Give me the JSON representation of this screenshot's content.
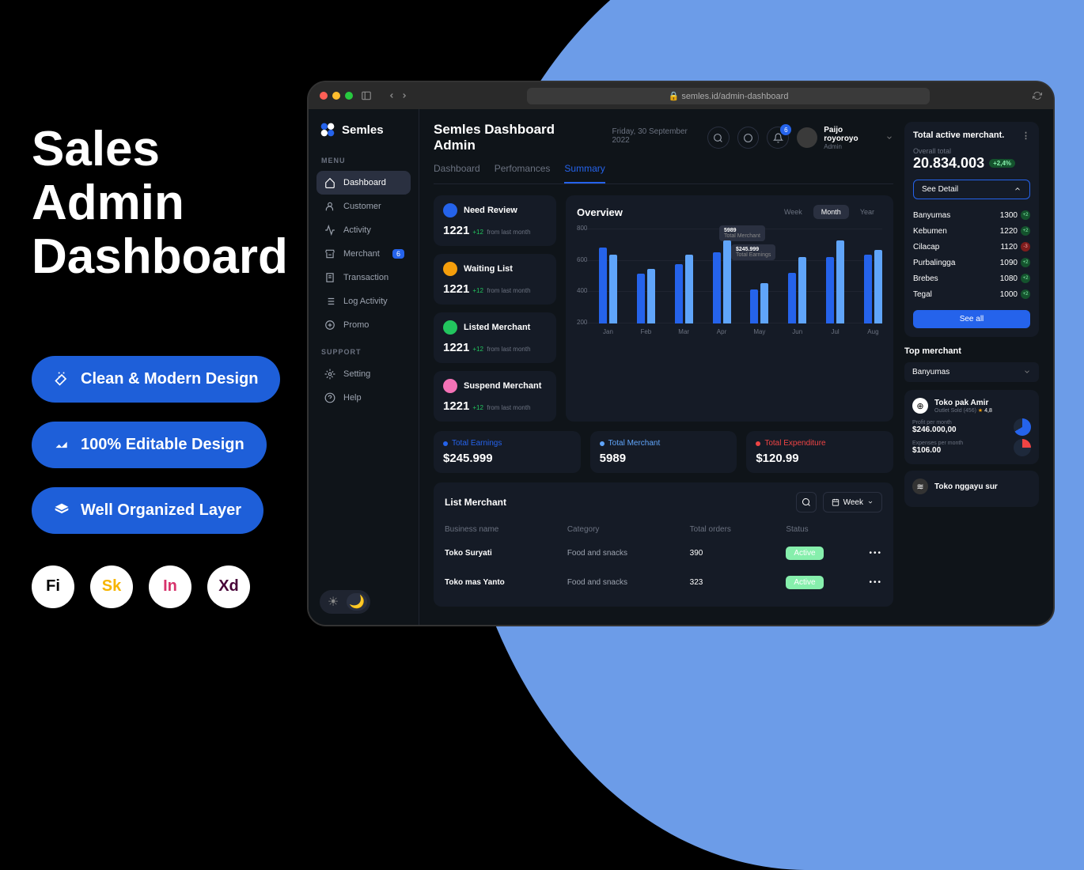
{
  "promo": {
    "title_line1": "Sales",
    "title_line2": "Admin",
    "title_line3": "Dashboard",
    "pills": [
      "Clean & Modern  Design",
      "100% Editable Design",
      "Well Organized Layer"
    ],
    "tools": [
      "Fi",
      "Sk",
      "In",
      "Xd"
    ]
  },
  "browser": {
    "url": "semles.id/admin-dashboard"
  },
  "brand": {
    "name": "Semles"
  },
  "menu": {
    "label_main": "MENU",
    "label_support": "SUPPORT",
    "items": [
      "Dashboard",
      "Customer",
      "Activity",
      "Merchant",
      "Transaction",
      "Log Activity",
      "Promo"
    ],
    "support": [
      "Setting",
      "Help"
    ],
    "merchant_badge": "6"
  },
  "header": {
    "title": "Semles Dashboard Admin",
    "date": "Friday, 30 September 2022",
    "notif_badge": "6",
    "user": {
      "name": "Paijo royoroyo",
      "role": "Admin"
    }
  },
  "tabs": [
    "Dashboard",
    "Perfomances",
    "Summary"
  ],
  "cards": [
    {
      "title": "Need Review",
      "value": "1221",
      "delta": "+12",
      "sub": "from last month",
      "color": "#2563eb"
    },
    {
      "title": "Waiting List",
      "value": "1221",
      "delta": "+12",
      "sub": "from last month",
      "color": "#f59e0b"
    },
    {
      "title": "Listed Merchant",
      "value": "1221",
      "delta": "+12",
      "sub": "from last month",
      "color": "#22c55e"
    },
    {
      "title": "Suspend Merchant",
      "value": "1221",
      "delta": "+12",
      "sub": "from last month",
      "color": "#f472b6"
    }
  ],
  "overview": {
    "title": "Overview",
    "time_opts": [
      "Week",
      "Month",
      "Year"
    ],
    "tooltip1": {
      "value": "5989",
      "label": "Total Merchant"
    },
    "tooltip2": {
      "value": "$245.999",
      "label": "Total Earnings"
    }
  },
  "chart_data": {
    "type": "bar",
    "categories": [
      "Jan",
      "Feb",
      "Mar",
      "Apr",
      "May",
      "Jun",
      "Jul",
      "Aug"
    ],
    "series": [
      {
        "name": "s1",
        "values": [
          640,
          420,
          500,
          600,
          290,
          430,
          560,
          580
        ]
      },
      {
        "name": "s2",
        "values": [
          580,
          460,
          580,
          700,
          340,
          560,
          700,
          620
        ]
      }
    ],
    "ylim": [
      0,
      800
    ],
    "ticks": [
      800,
      600,
      400,
      200
    ]
  },
  "metrics": [
    {
      "label": "Total Earnings",
      "value": "$245.999",
      "color": "#2563eb"
    },
    {
      "label": "Total Merchant",
      "value": "5989",
      "color": "#60a5fa"
    },
    {
      "label": "Total Expenditure",
      "value": "$120.99",
      "color": "#ef4444"
    }
  ],
  "list": {
    "title": "List Merchant",
    "week_label": "Week",
    "columns": [
      "Business name",
      "Category",
      "Total orders",
      "Status"
    ],
    "rows": [
      {
        "name": "Toko Suryati",
        "category": "Food and snacks",
        "orders": "390",
        "status": "Active"
      },
      {
        "name": "Toko mas Yanto",
        "category": "Food and snacks",
        "orders": "323",
        "status": "Active"
      }
    ]
  },
  "right": {
    "title": "Total active merchant.",
    "overall_label": "Overall total",
    "overall_value": "20.834.003",
    "overall_delta": "+2,4%",
    "see_detail": "See Detail",
    "regions": [
      {
        "name": "Banyumas",
        "value": "1300",
        "delta": "+2",
        "positive": true
      },
      {
        "name": "Kebumen",
        "value": "1220",
        "delta": "+2",
        "positive": true
      },
      {
        "name": "Cilacap",
        "value": "1120",
        "delta": "-3",
        "positive": false
      },
      {
        "name": "Purbalingga",
        "value": "1090",
        "delta": "+2",
        "positive": true
      },
      {
        "name": "Brebes",
        "value": "1080",
        "delta": "+2",
        "positive": true
      },
      {
        "name": "Tegal",
        "value": "1000",
        "delta": "+2",
        "positive": true
      }
    ],
    "see_all": "See all",
    "top_title": "Top merchant",
    "dropdown": "Banyumas",
    "merchants": [
      {
        "name": "Toko pak Amir",
        "sub": "Outlet Sold (456)",
        "rating": "4,8",
        "profit_label": "Profit per month",
        "profit": "$246.000,00",
        "expenses_label": "Expenses per month",
        "expenses": "$106.00"
      },
      {
        "name": "Toko nggayu sur"
      }
    ]
  }
}
